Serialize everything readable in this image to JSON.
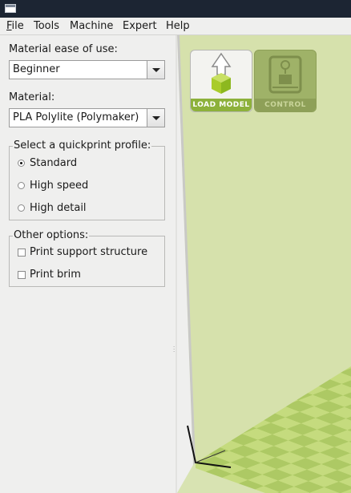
{
  "window": {
    "icon": "window-icon"
  },
  "menu": {
    "items": [
      "File",
      "Tools",
      "Machine",
      "Expert",
      "Help"
    ],
    "file_underline": "F",
    "file_rest": "ile"
  },
  "panel": {
    "ease_label": "Material ease of use:",
    "ease_value": "Beginner",
    "material_label": "Material:",
    "material_value": "PLA Polylite (Polymaker)",
    "profile_group": "Select a quickprint profile:",
    "profiles": [
      {
        "label": "Standard",
        "selected": true
      },
      {
        "label": "High speed",
        "selected": false
      },
      {
        "label": "High detail",
        "selected": false
      }
    ],
    "other_group": "Other options:",
    "options": [
      {
        "label": "Print support structure",
        "checked": false
      },
      {
        "label": "Print brim",
        "checked": false
      }
    ]
  },
  "toolbar": {
    "load_label": "LOAD MODEL",
    "control_label": "CONTROL",
    "load_icon": "load-model-icon",
    "control_icon": "control-printer-icon"
  },
  "colors": {
    "viewport_bg": "#d8e3b2",
    "grid_light": "#c5db7e",
    "grid_dark": "#adc964",
    "accent_green": "#8db13b",
    "titlebar": "#1c2533"
  }
}
